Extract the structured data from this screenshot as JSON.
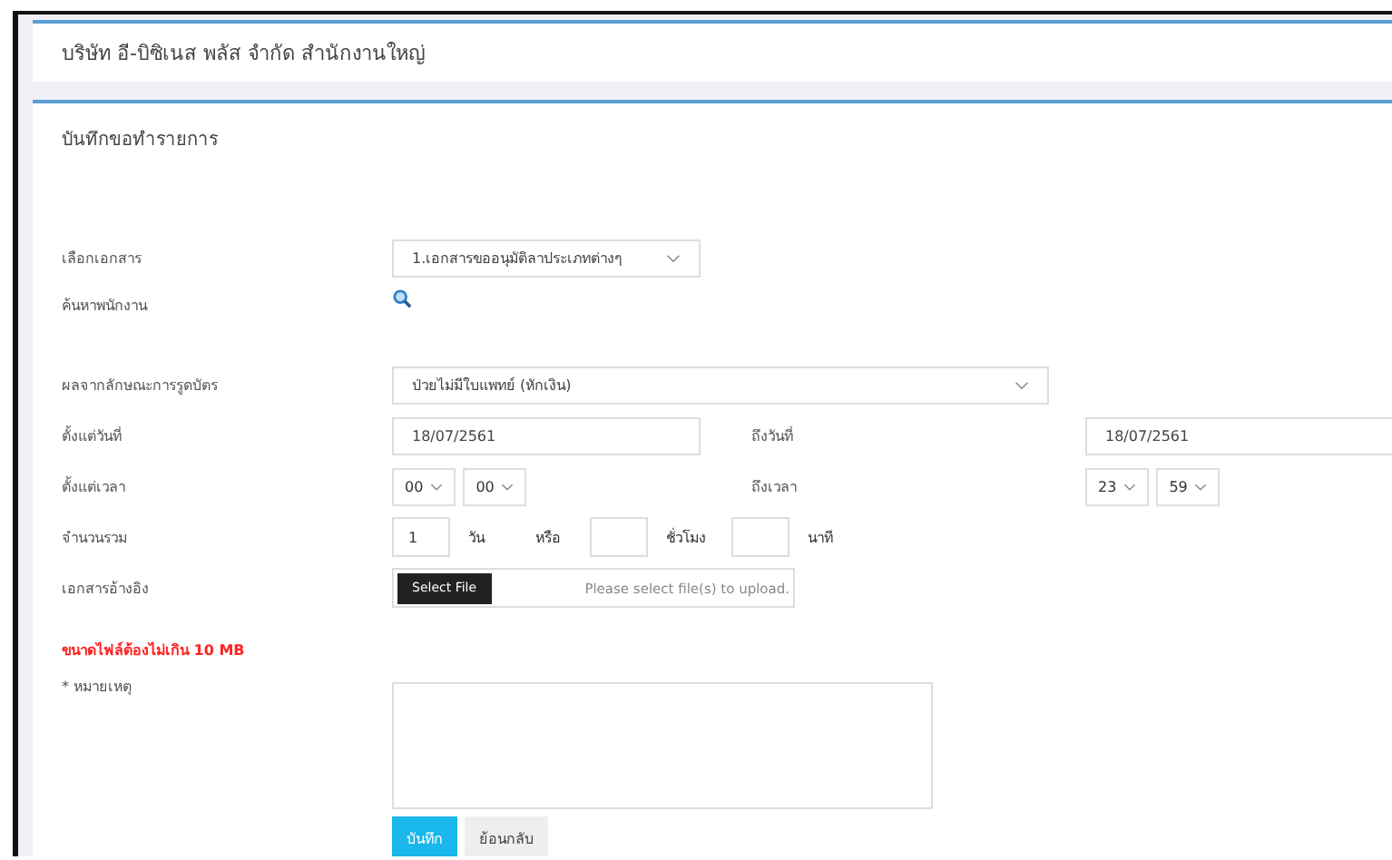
{
  "company_title": "บริษัท อี-บิซิเนส พลัส จำกัด สำนักงานใหญ่",
  "panel_title": "บันทึกขอทำรายการ",
  "document": {
    "label": "เลือกเอกสาร",
    "value": "1.เอกสารขออนุมัติลาประเภทต่างๆ"
  },
  "employee_search": {
    "label": "ค้นหาพนักงาน"
  },
  "card_result": {
    "label": "ผลจากลักษณะการรูดบัตร",
    "value": "ป่วยไม่มีใบแพทย์ (หักเงิน)"
  },
  "date_from": {
    "label": "ตั้งแต่วันที่",
    "value": "18/07/2561"
  },
  "date_to": {
    "label": "ถึงวันที่",
    "value": "18/07/2561"
  },
  "time_from": {
    "label": "ตั้งแต่เวลา",
    "hour": "00",
    "minute": "00"
  },
  "time_to": {
    "label": "ถึงเวลา",
    "hour": "23",
    "minute": "59"
  },
  "total": {
    "label": "จำนวนรวม",
    "parts": [
      {
        "value": "1",
        "unit": "วัน"
      },
      {
        "unit": "ชั่วโมง",
        "prefix": "หรือ"
      },
      {
        "unit": "นาที"
      }
    ]
  },
  "reference": {
    "label": "เอกสารอ้างอิง",
    "button": "Select File",
    "placeholder": "Please select file(s) to upload."
  },
  "size_warning": "ขนาดไฟล์ต้องไม่เกิน 10 MB",
  "remark": {
    "label": "* หมายเหตุ"
  },
  "buttons": [
    {
      "label": "บันทึก",
      "kind": "primary"
    },
    {
      "label": "ย้อนกลับ",
      "kind": "secondary"
    }
  ]
}
